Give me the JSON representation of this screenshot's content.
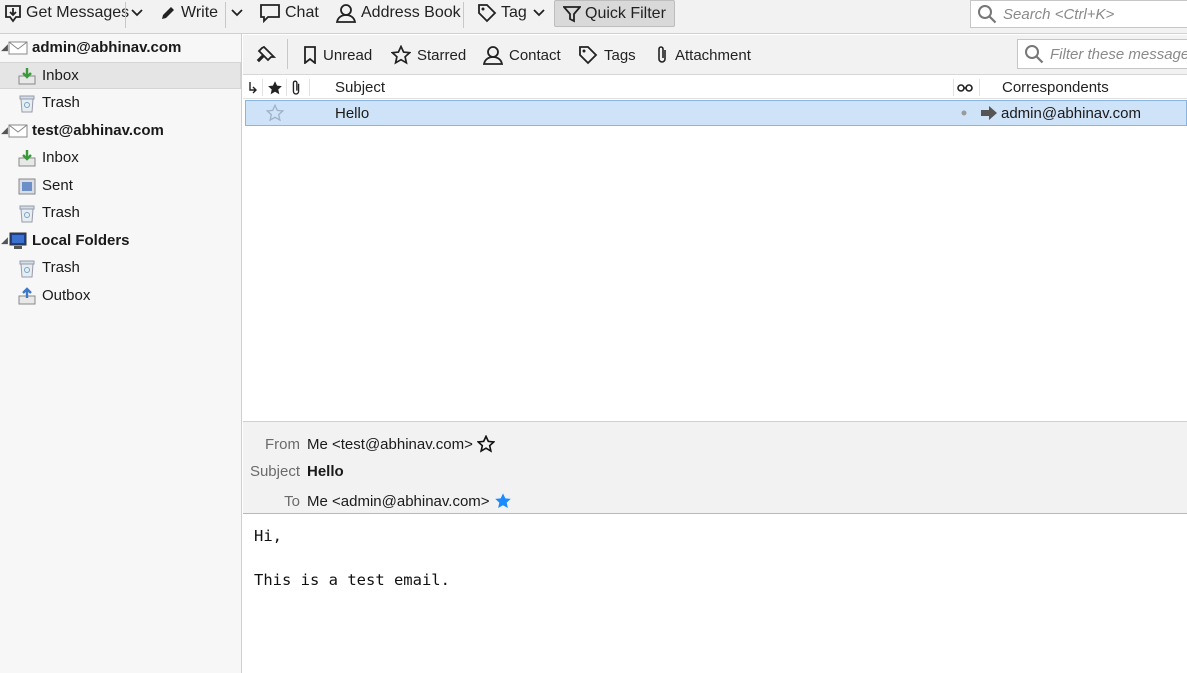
{
  "toolbar": {
    "get_messages": "Get Messages",
    "write": "Write",
    "chat": "Chat",
    "address_book": "Address Book",
    "tag": "Tag",
    "quick_filter": "Quick Filter",
    "search_placeholder": "Search <Ctrl+K>"
  },
  "folders": {
    "accounts": [
      {
        "name": "admin@abhinav.com",
        "folders": [
          "Inbox",
          "Trash"
        ]
      },
      {
        "name": "test@abhinav.com",
        "folders": [
          "Inbox",
          "Sent",
          "Trash"
        ]
      },
      {
        "name": "Local Folders",
        "folders": [
          "Trash",
          "Outbox"
        ]
      }
    ],
    "selected": "admin@abhinav.com/Inbox"
  },
  "quick_filter_bar": {
    "unread": "Unread",
    "starred": "Starred",
    "contact": "Contact",
    "tags": "Tags",
    "attachment": "Attachment",
    "filter_placeholder": "Filter these messages <Ctrl+Shift+K>"
  },
  "thread_pane": {
    "columns": {
      "subject": "Subject",
      "correspondents": "Correspondents"
    },
    "messages": [
      {
        "subject": "Hello",
        "correspondent": "admin@abhinav.com",
        "starred": false,
        "selected": true
      }
    ]
  },
  "message": {
    "from_label": "From",
    "from_value": "Me <test@abhinav.com>",
    "subject_label": "Subject",
    "subject_value": "Hello",
    "to_label": "To",
    "to_value": "Me <admin@abhinav.com>",
    "body": "Hi,\n\nThis is a test email."
  },
  "colors": {
    "selection_bg": "#cfe3f8",
    "selection_border": "#8ab4e2",
    "star_blue": "#1a8cff",
    "toolbar_bg": "#f2f2f2"
  }
}
